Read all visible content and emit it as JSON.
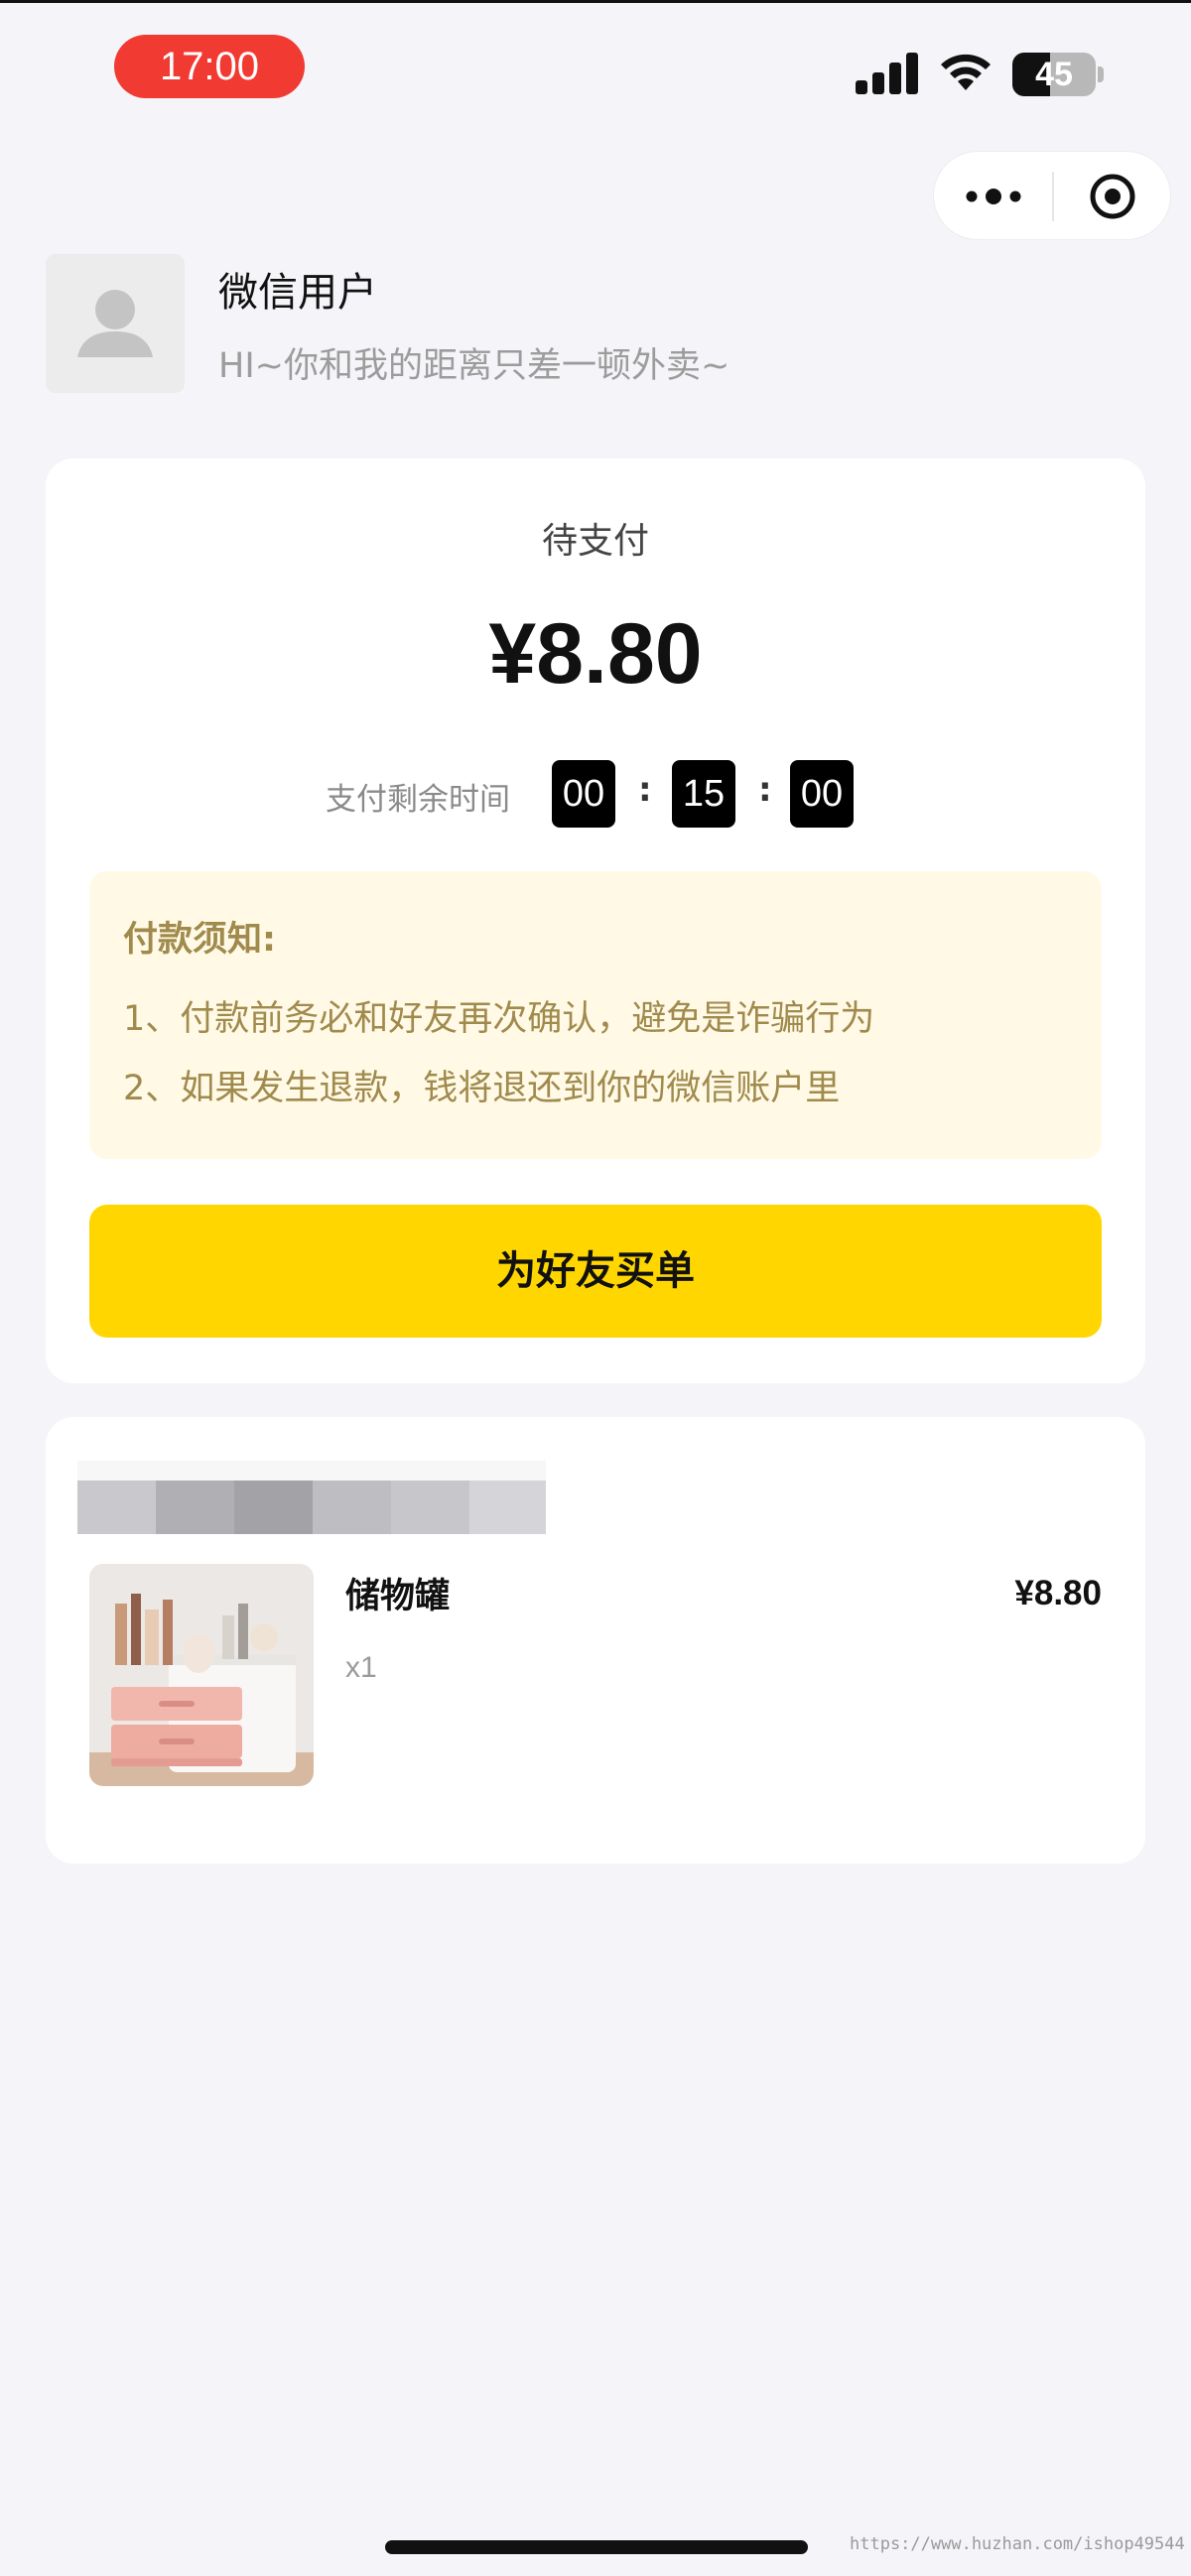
{
  "status_bar": {
    "time": "17:00",
    "battery_level": "45",
    "battery_percent": 45,
    "signal_bars": 4,
    "time_pill_color": "#f03a32"
  },
  "capsule": {
    "more_icon": "more-dots-icon",
    "close_icon": "target-close-icon"
  },
  "user": {
    "name": "微信用户",
    "greeting": "HI~你和我的距离只差一顿外卖~",
    "avatar_icon": "user-silhouette-icon"
  },
  "payment": {
    "status": "待支付",
    "amount": "¥8.80",
    "countdown_label": "支付剩余时间",
    "countdown": {
      "hours": "00",
      "minutes": "15",
      "seconds": "00"
    },
    "separator": ":",
    "notice": {
      "title": "付款须知:",
      "lines": [
        "1、付款前务必和好友再次确认，避免是诈骗行为",
        "2、如果发生退款，钱将退还到你的微信账户里"
      ]
    },
    "button_label": "为好友买单",
    "accent_color": "#ffd600"
  },
  "order": {
    "store_name_blurred": true,
    "item": {
      "name": "储物罐",
      "quantity": "x1",
      "price": "¥8.80"
    }
  },
  "watermark": "https://www.huzhan.com/ishop49544"
}
